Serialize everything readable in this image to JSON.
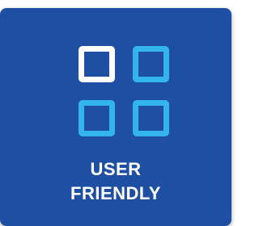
{
  "feature": {
    "label_lines": [
      "USER",
      "FRIENDLY"
    ],
    "icon": "grid-layout-icon",
    "colors": {
      "card_background": "#1f4fa3",
      "highlight_cell": "#ffffff",
      "cell": "#33b5ec",
      "text": "#ffffff"
    }
  }
}
